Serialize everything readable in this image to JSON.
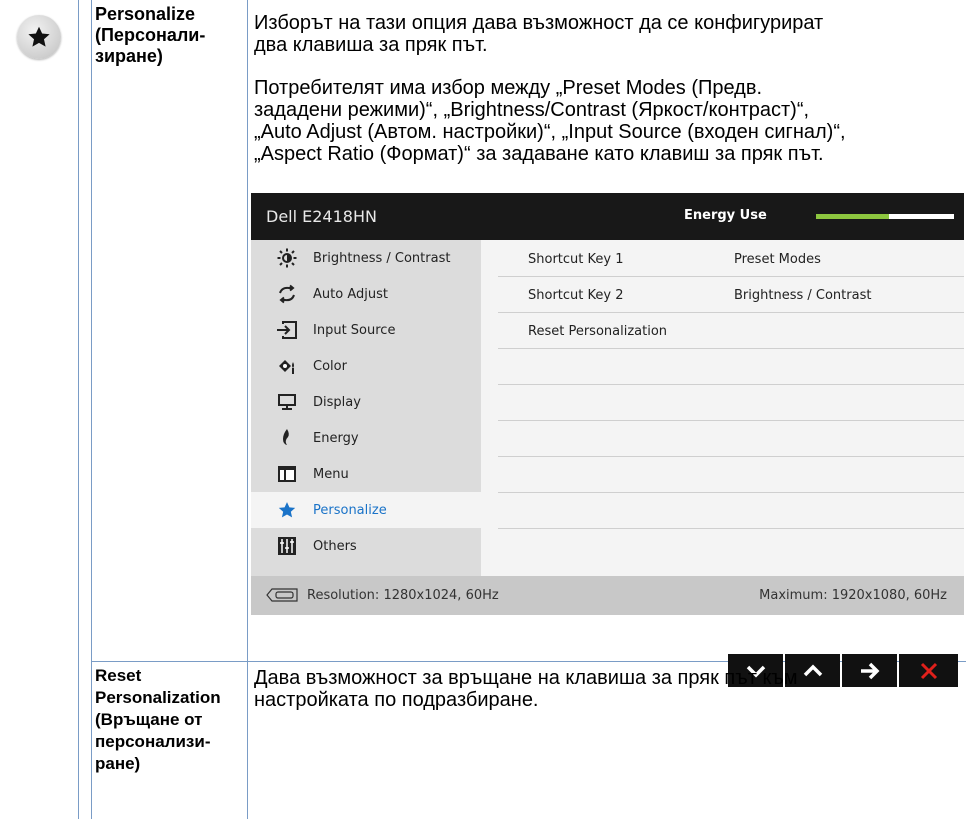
{
  "row1": {
    "label_lines": [
      "Personalize",
      "(Персонали-",
      "зиране)"
    ],
    "desc1_lines": [
      "Изборът на тази опция дава възможност да се конфигурират",
      "два клавиша за пряк път."
    ],
    "desc2_lines": [
      "Потребителят има избор между „Preset Modes (Предв.",
      "зададени режими)“, „Brightness/Contrast (Яркост/контраст)“,",
      "„Auto Adjust (Автом. настройки)“, „Input Source (входен сигнал)“,",
      "„Aspect Ratio (Формат)“ за задаване като клавиш за пряк път."
    ],
    "icon": "star-icon"
  },
  "osd": {
    "title": "Dell E2418HN",
    "energy_label": "Energy Use",
    "energy_level": 0.53,
    "menu_items": [
      {
        "label": "Brightness / Contrast",
        "icon": "brightness-icon"
      },
      {
        "label": "Auto Adjust",
        "icon": "auto-adjust-icon"
      },
      {
        "label": "Input Source",
        "icon": "input-source-icon"
      },
      {
        "label": "Color",
        "icon": "color-icon"
      },
      {
        "label": "Display",
        "icon": "display-icon"
      },
      {
        "label": "Energy",
        "icon": "energy-icon"
      },
      {
        "label": "Menu",
        "icon": "menu-icon"
      },
      {
        "label": "Personalize",
        "icon": "star-icon",
        "active": true
      },
      {
        "label": "Others",
        "icon": "others-icon"
      }
    ],
    "settings": [
      {
        "name": "Shortcut Key 1",
        "value": "Preset Modes"
      },
      {
        "name": "Shortcut Key 2",
        "value": "Brightness / Contrast"
      },
      {
        "name": "Reset Personalization",
        "value": ""
      }
    ],
    "resolution": "Resolution: 1280x1024, 60Hz",
    "maximum": "Maximum: 1920x1080, 60Hz",
    "nav_buttons": [
      "down-icon",
      "up-icon",
      "right-arrow-icon",
      "close-icon"
    ],
    "accent_color": "#1a73c8",
    "energy_color": "#8dc63f",
    "close_color": "#e0201b"
  },
  "row2": {
    "label_lines": [
      "Reset",
      "Personalization",
      "(Връщане от",
      "персонализи-",
      "ране)"
    ],
    "desc_lines": [
      "Дава възможност за връщане на клавиша за пряк път към",
      "настройката по подразбиране."
    ]
  }
}
